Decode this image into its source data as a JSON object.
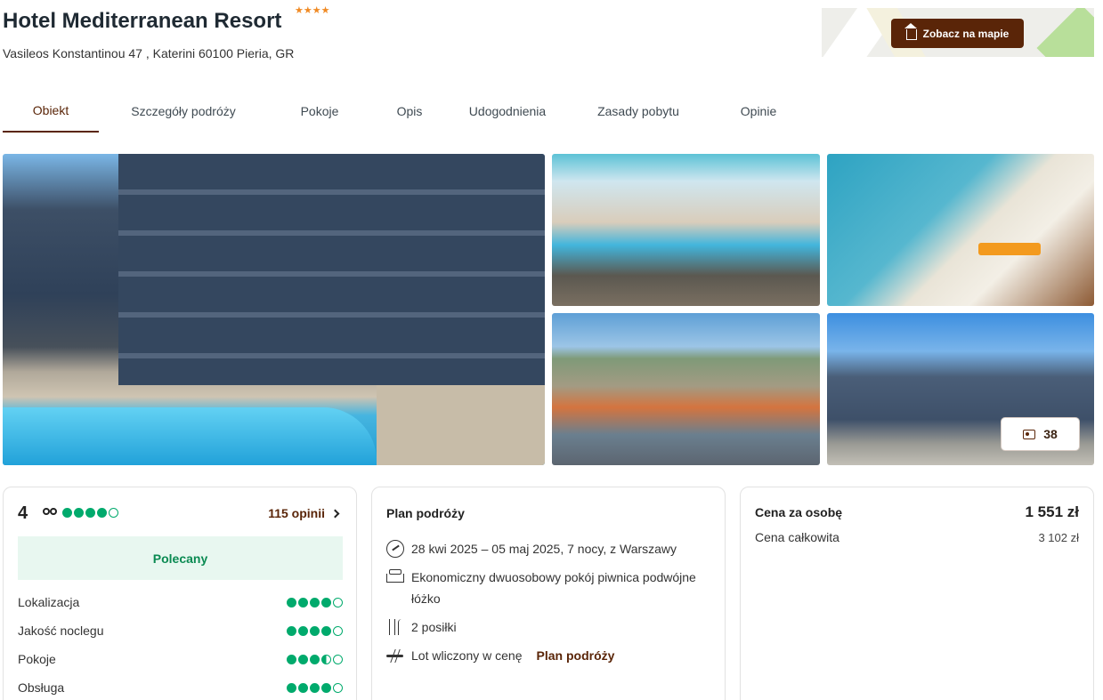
{
  "hotel": {
    "name": "Hotel Mediterranean Resort",
    "stars": "★★★★",
    "address": "Vasileos Konstantinou 47 , Katerini 60100 Pieria, GR"
  },
  "map": {
    "button_label": "Zobacz na mapie",
    "icon": "home-icon"
  },
  "tabs": [
    "Obiekt",
    "Szczegóły podróży",
    "Pokoje",
    "Opis",
    "Udogodnienia",
    "Zasady pobytu",
    "Opinie"
  ],
  "gallery": {
    "photo_count": "38",
    "icon": "gallery-icon"
  },
  "reviews": {
    "score": "4",
    "score_dots": 4,
    "count_link": "115 opinii",
    "badge": "Polecany",
    "ratings": [
      {
        "label": "Lokalizacja",
        "dots": 4
      },
      {
        "label": "Jakość noclegu",
        "dots": 4
      },
      {
        "label": "Pokoje",
        "dots": 3.5
      },
      {
        "label": "Obsługa",
        "dots": 4
      }
    ]
  },
  "plan": {
    "heading": "Plan podróży",
    "dates": "28 kwi 2025 – 05 maj 2025, 7 nocy, z Warszawy",
    "room": "Ekonomiczny dwuosobowy pokój piwnica podwójne łóżko",
    "meals": "2 posiłki",
    "flight": "Lot wliczony w cenę",
    "flight_link": "Plan podróży"
  },
  "price": {
    "per_person_label": "Cena za osobę",
    "per_person_value": "1 551 zł",
    "total_label": "Cena całkowita",
    "total_value": "3 102 zł"
  },
  "colors": {
    "accent": "#5a2508",
    "rating": "#00aa6c",
    "badge_bg": "#e8f7f0",
    "stars": "#f08a24"
  }
}
